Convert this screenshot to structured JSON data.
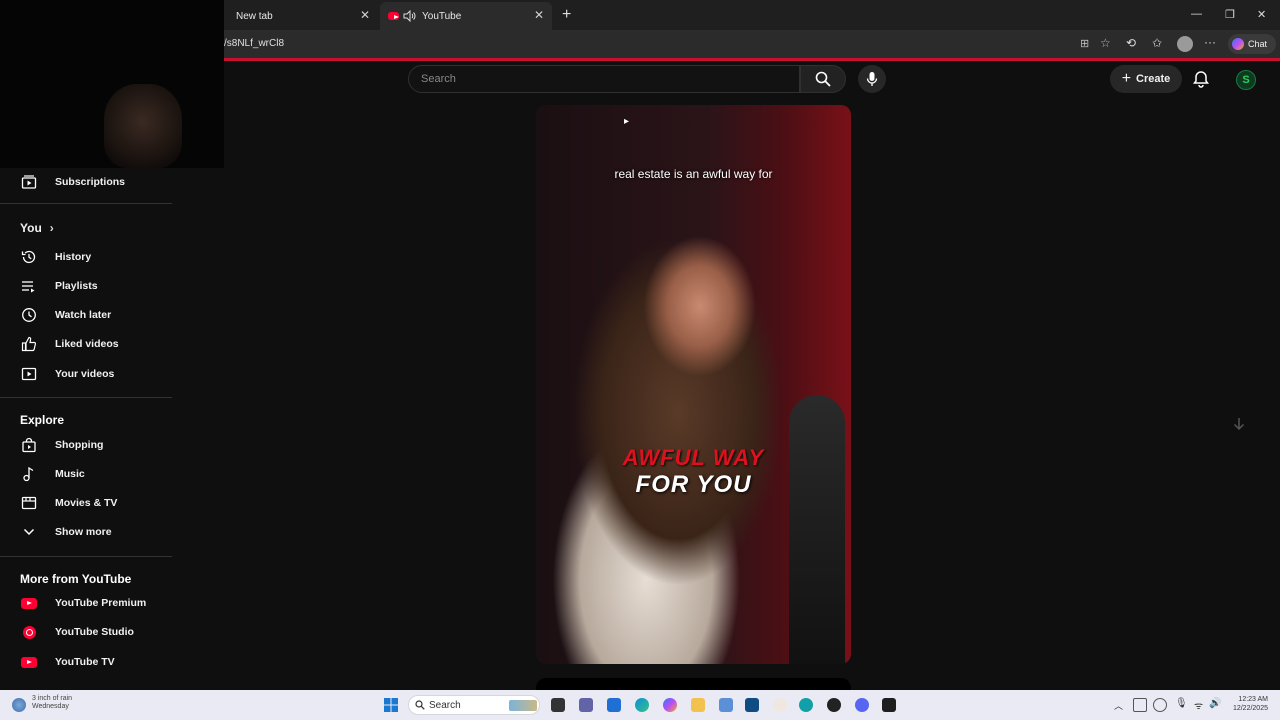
{
  "browser": {
    "tabs": [
      {
        "title": "New tab"
      },
      {
        "title": "YouTube"
      }
    ],
    "url_fragment": "/s8NLf_wrCl8",
    "chat_label": "Chat"
  },
  "masthead": {
    "search_placeholder": "Search",
    "create_label": "Create"
  },
  "sidebar": {
    "subscriptions": "Subscriptions",
    "you_header": "You",
    "you_items": [
      "History",
      "Playlists",
      "Watch later",
      "Liked videos",
      "Your videos"
    ],
    "explore_header": "Explore",
    "explore_items": [
      "Shopping",
      "Music",
      "Movies & TV",
      "Show more"
    ],
    "more_header": "More from YouTube",
    "more_items": [
      "YouTube Premium",
      "YouTube Studio",
      "YouTube TV"
    ]
  },
  "video": {
    "caption_top": "real estate is an awful way for",
    "caption_red": "AWFUL WAY",
    "caption_white": "FOR YOU"
  },
  "taskbar": {
    "weather_line1": "3 inch of rain",
    "weather_line2": "Wednesday",
    "search_label": "Search",
    "time": "12:23 AM",
    "date": "12/22/2025"
  },
  "colors": {
    "accent_red": "#ff0033",
    "caption_red": "#e0111f",
    "background": "#0f0f0f"
  }
}
